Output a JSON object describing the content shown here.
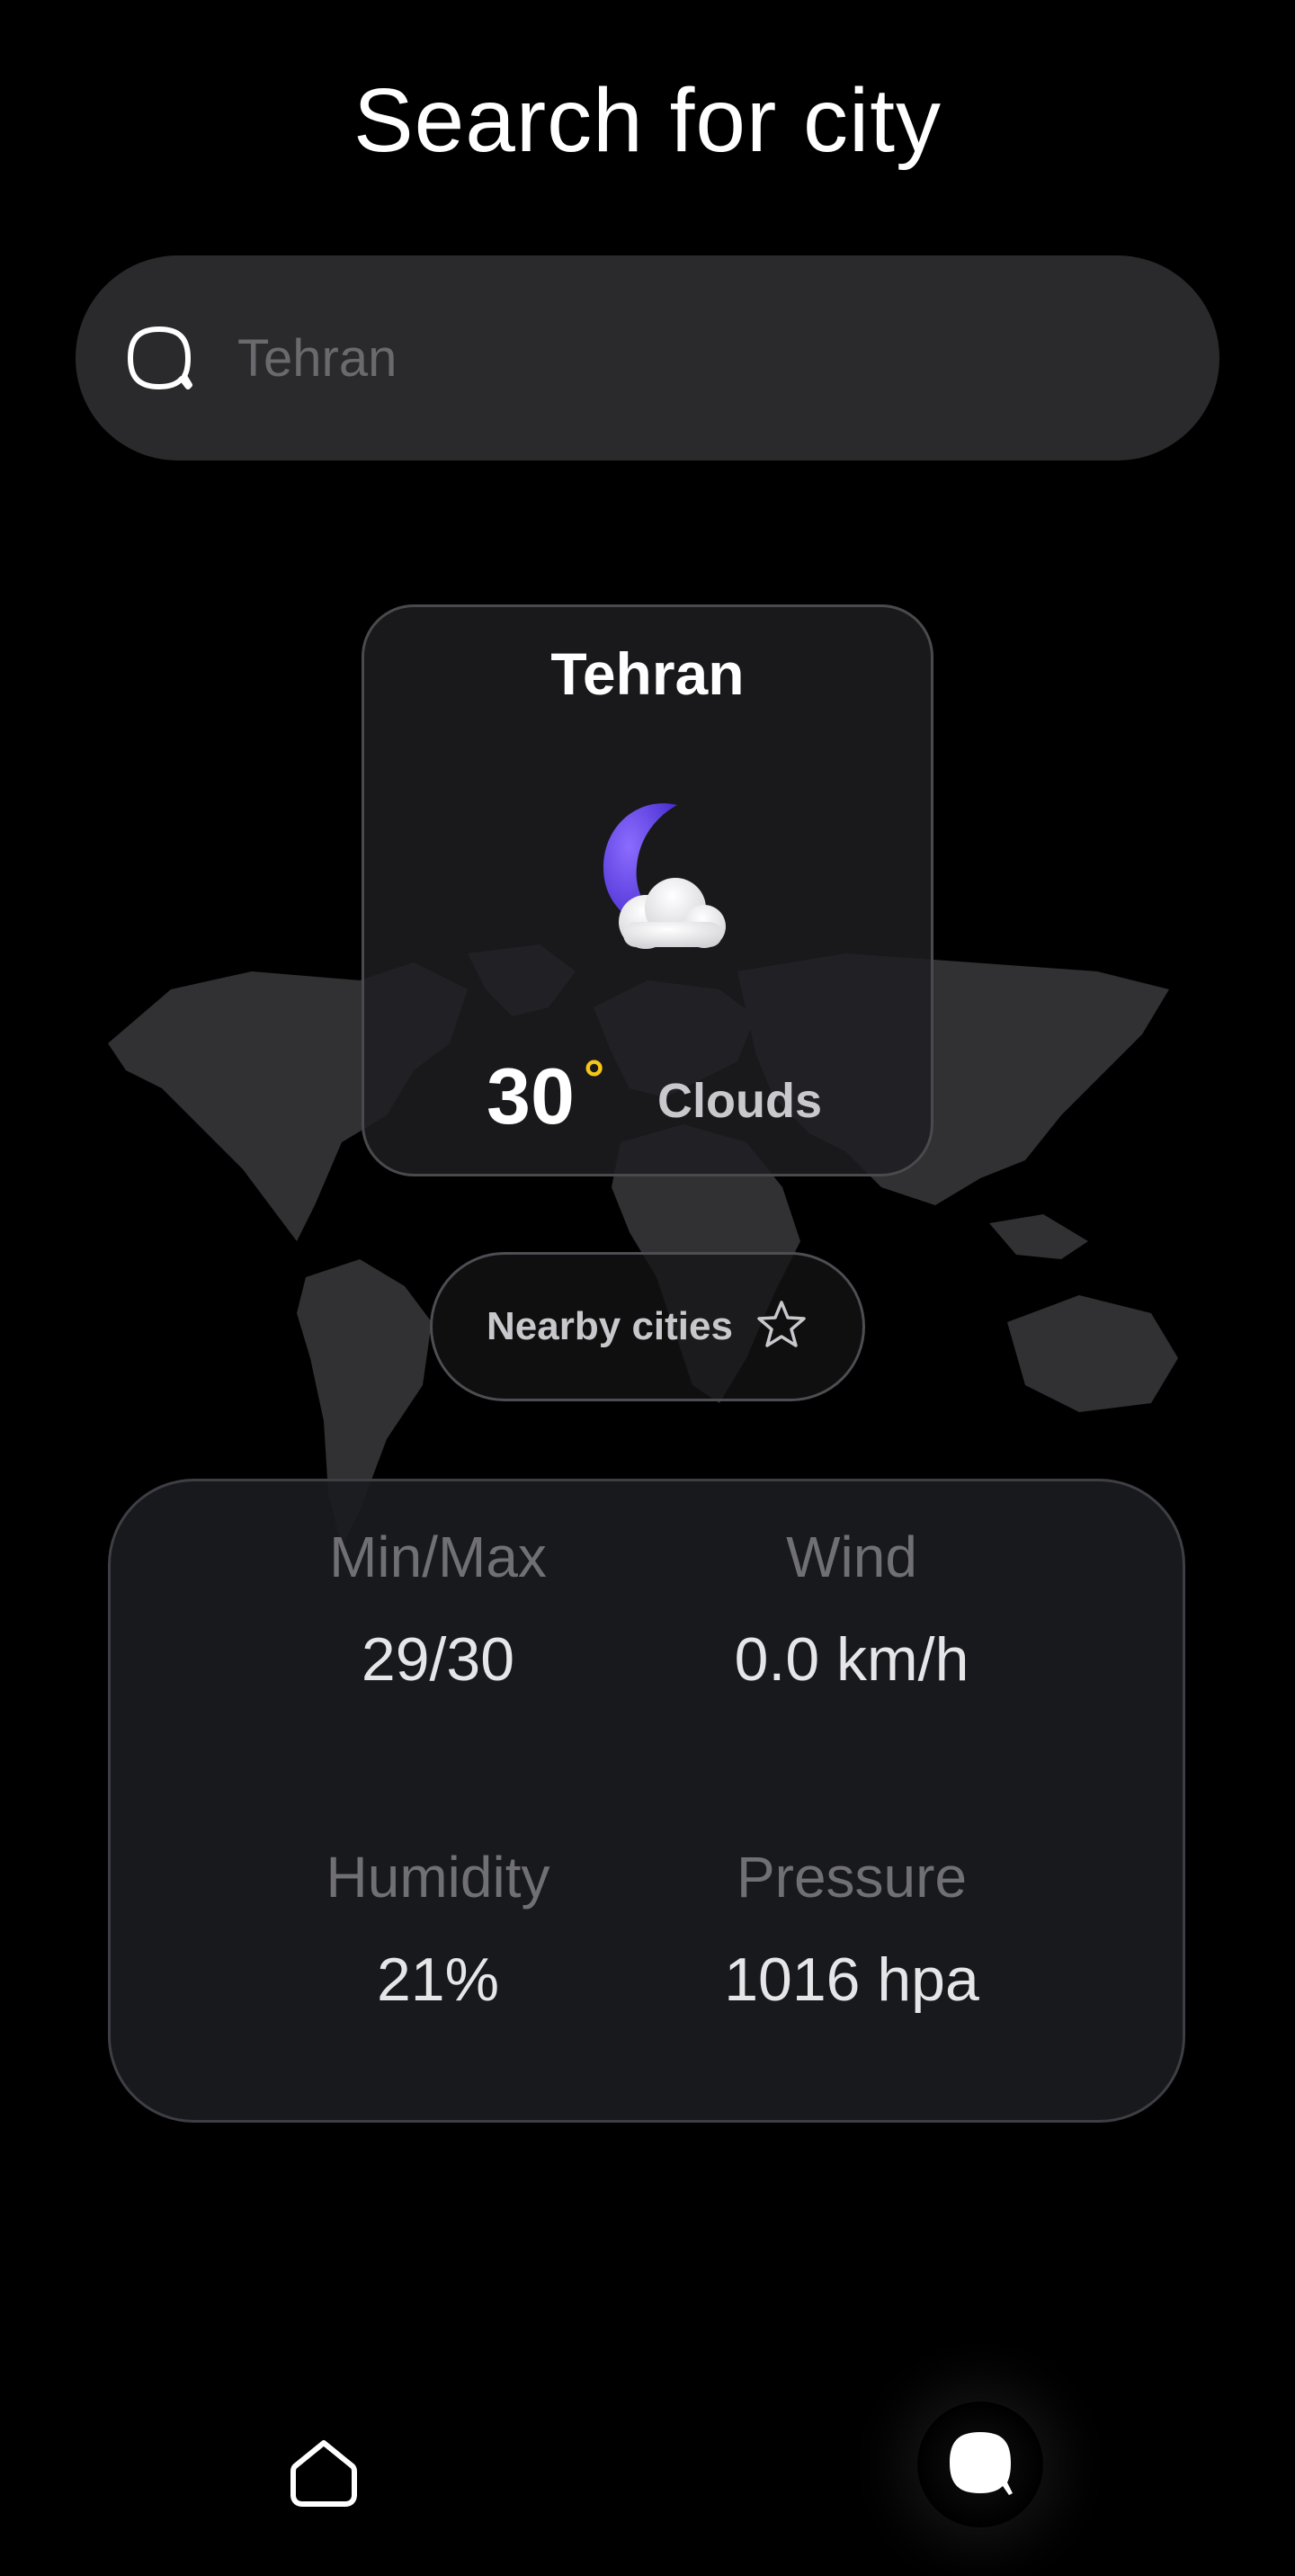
{
  "header": {
    "title": "Search for city"
  },
  "search": {
    "placeholder": "Tehran",
    "value": "",
    "icon": "search-icon"
  },
  "city_card": {
    "city": "Tehran",
    "temperature": "30",
    "degree_symbol": "°",
    "condition": "Clouds",
    "weather_icon": "moon-cloud-icon"
  },
  "nearby": {
    "label": "Nearby cities",
    "icon": "star-icon"
  },
  "stats": {
    "minmax_label": "Min/Max",
    "minmax_value": "29/30",
    "wind_label": "Wind",
    "wind_value": "0.0 km/h",
    "humidity_label": "Humidity",
    "humidity_value": "21%",
    "pressure_label": "Pressure",
    "pressure_value": "1016 hpa"
  },
  "bottom_nav": {
    "items": [
      {
        "icon": "home-icon",
        "active": false
      },
      {
        "icon": "search-icon",
        "active": true
      }
    ]
  },
  "colors": {
    "background": "#000000",
    "surface": "#2a2a2c",
    "accent_degree": "#f5c518",
    "moon": "#5b3fe0"
  }
}
